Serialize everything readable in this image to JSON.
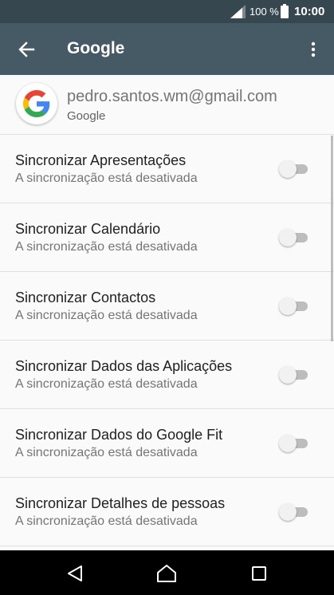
{
  "status_bar": {
    "battery_percent": "100 %",
    "time": "10:00",
    "signal_icon": "signal-icon",
    "battery_icon": "battery-icon"
  },
  "app_bar": {
    "title": "Google",
    "back_icon": "arrow-back-icon",
    "menu_icon": "more-vert-icon"
  },
  "account": {
    "email": "pedro.santos.wm@gmail.com",
    "type": "Google"
  },
  "sync_items": [
    {
      "label": "Sincronizar Apresentações",
      "status": "A sincronização está desativada",
      "enabled": false
    },
    {
      "label": "Sincronizar Calendário",
      "status": "A sincronização está desativada",
      "enabled": false
    },
    {
      "label": "Sincronizar Contactos",
      "status": "A sincronização está desativada",
      "enabled": false
    },
    {
      "label": "Sincronizar Dados das Aplicações",
      "status": "A sincronização está desativada",
      "enabled": false
    },
    {
      "label": "Sincronizar Dados do Google Fit",
      "status": "A sincronização está desativada",
      "enabled": false
    },
    {
      "label": "Sincronizar Detalhes de pessoas",
      "status": "A sincronização está desativada",
      "enabled": false
    }
  ],
  "nav_bar": {
    "back_icon": "nav-back-icon",
    "home_icon": "nav-home-icon",
    "recents_icon": "nav-recents-icon"
  },
  "colors": {
    "status_bar": "#37474f",
    "app_bar": "#455a64",
    "background": "#fafafa",
    "nav_bar": "#000000"
  }
}
